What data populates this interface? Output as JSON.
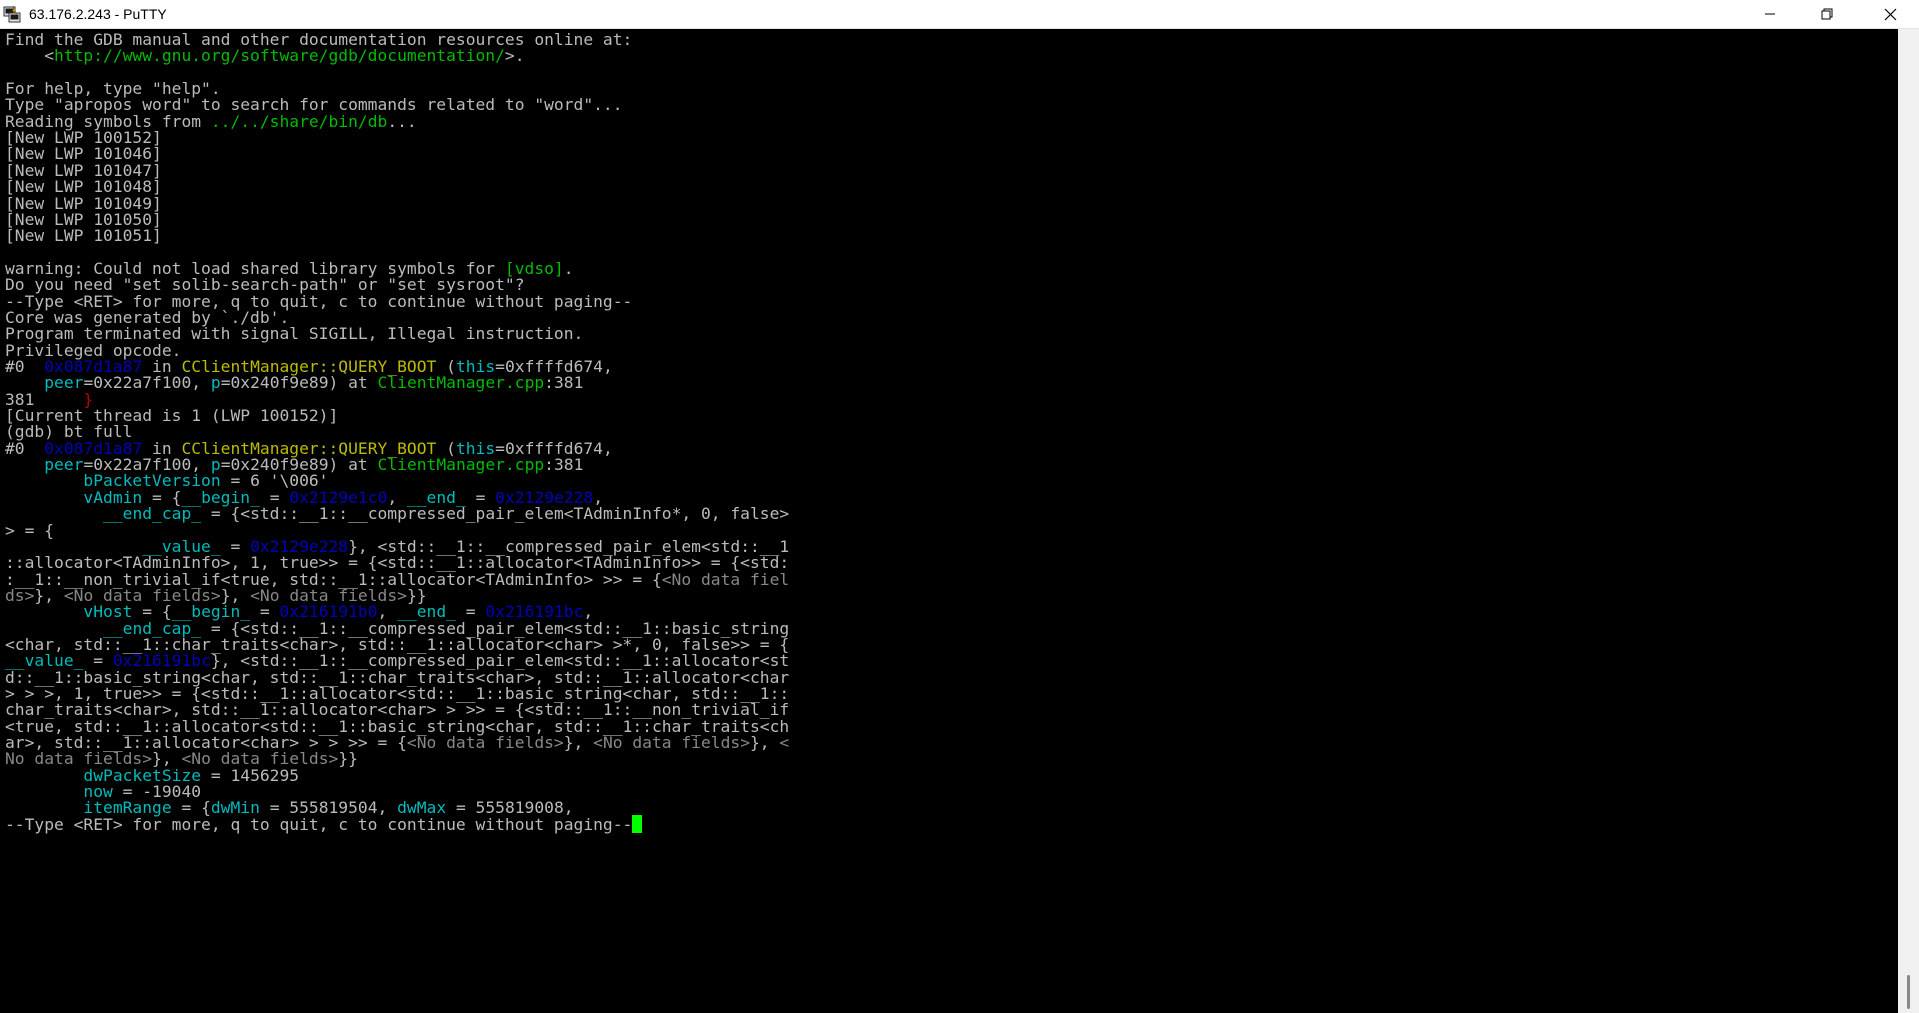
{
  "window": {
    "title": "63.176.2.243 - PuTTY",
    "app_icon": "putty-icon",
    "controls": {
      "minimize": "minimize-icon",
      "maximize": "restore-icon",
      "close": "close-icon"
    }
  },
  "colors": {
    "background": "#000000",
    "text": "#bbbbbb",
    "green": "#00bb00",
    "yellow": "#bbbb00",
    "blue": "#0000bb",
    "cyan": "#00bbbb",
    "red": "#bb0000",
    "gray": "#888888",
    "cursor": "#00ff00"
  },
  "terminal": {
    "lines": [
      [
        [
          "n",
          "Find the GDB manual and other documentation resources online at:"
        ]
      ],
      [
        [
          "n",
          "    <"
        ],
        [
          "u",
          "http://www.gnu.org/software/gdb/documentation/"
        ],
        [
          "n",
          ">."
        ]
      ],
      [],
      [
        [
          "n",
          "For help, type \"help\"."
        ]
      ],
      [
        [
          "n",
          "Type \"apropos word\" to search for commands related to \"word\"..."
        ]
      ],
      [
        [
          "n",
          "Reading symbols from "
        ],
        [
          "u",
          "../../share/bin/db"
        ],
        [
          "n",
          "..."
        ]
      ],
      [
        [
          "n",
          "[New LWP 100152]"
        ]
      ],
      [
        [
          "n",
          "[New LWP 101046]"
        ]
      ],
      [
        [
          "n",
          "[New LWP 101047]"
        ]
      ],
      [
        [
          "n",
          "[New LWP 101048]"
        ]
      ],
      [
        [
          "n",
          "[New LWP 101049]"
        ]
      ],
      [
        [
          "n",
          "[New LWP 101050]"
        ]
      ],
      [
        [
          "n",
          "[New LWP 101051]"
        ]
      ],
      [],
      [
        [
          "n",
          "warning: Could not load shared library symbols for "
        ],
        [
          "u",
          "[vdso]"
        ],
        [
          "n",
          "."
        ]
      ],
      [
        [
          "n",
          "Do you need \"set solib-search-path\" or \"set sysroot\"?"
        ]
      ],
      [
        [
          "n",
          "--Type <RET> for more, q to quit, c to continue without paging--"
        ]
      ],
      [
        [
          "n",
          "Core was generated by `./db'."
        ]
      ],
      [
        [
          "n",
          "Program terminated with signal SIGILL, Illegal instruction."
        ]
      ],
      [
        [
          "n",
          "Privileged opcode."
        ]
      ],
      [
        [
          "n",
          "#0  "
        ],
        [
          "a",
          "0x087d1a87"
        ],
        [
          "n",
          " in "
        ],
        [
          "f",
          "CClientManager::QUERY_BOOT"
        ],
        [
          "n",
          " ("
        ],
        [
          "v",
          "this"
        ],
        [
          "n",
          "=0xffffd674,"
        ]
      ],
      [
        [
          "n",
          "    "
        ],
        [
          "v",
          "peer"
        ],
        [
          "n",
          "=0x22a7f100, "
        ],
        [
          "v",
          "p"
        ],
        [
          "n",
          "=0x240f9e89) at "
        ],
        [
          "u",
          "ClientManager.cpp"
        ],
        [
          "n",
          ":381"
        ]
      ],
      [
        [
          "n",
          "381     "
        ],
        [
          "r",
          "}"
        ]
      ],
      [
        [
          "n",
          "[Current thread is 1 (LWP 100152)]"
        ]
      ],
      [
        [
          "n",
          "(gdb) bt full"
        ]
      ],
      [
        [
          "n",
          "#0  "
        ],
        [
          "a",
          "0x087d1a87"
        ],
        [
          "n",
          " in "
        ],
        [
          "f",
          "CClientManager::QUERY_BOOT"
        ],
        [
          "n",
          " ("
        ],
        [
          "v",
          "this"
        ],
        [
          "n",
          "=0xffffd674,"
        ]
      ],
      [
        [
          "n",
          "    "
        ],
        [
          "v",
          "peer"
        ],
        [
          "n",
          "=0x22a7f100, "
        ],
        [
          "v",
          "p"
        ],
        [
          "n",
          "=0x240f9e89) at "
        ],
        [
          "u",
          "ClientManager.cpp"
        ],
        [
          "n",
          ":381"
        ]
      ],
      [
        [
          "n",
          "        "
        ],
        [
          "v",
          "bPacketVersion"
        ],
        [
          "n",
          " = 6 '\\006'"
        ]
      ],
      [
        [
          "n",
          "        "
        ],
        [
          "v",
          "vAdmin"
        ],
        [
          "n",
          " = {"
        ],
        [
          "v",
          "__begin_"
        ],
        [
          "n",
          " = "
        ],
        [
          "a",
          "0x2129e1c0"
        ],
        [
          "n",
          ", "
        ],
        [
          "v",
          "__end_"
        ],
        [
          "n",
          " = "
        ],
        [
          "a",
          "0x2129e228"
        ],
        [
          "n",
          ","
        ]
      ],
      [
        [
          "n",
          "          "
        ],
        [
          "v",
          "__end_cap_"
        ],
        [
          "n",
          " = {<std::__1::__compressed_pair_elem<TAdminInfo*, 0, false>"
        ]
      ],
      [
        [
          "n",
          "> = {"
        ]
      ],
      [
        [
          "n",
          "              "
        ],
        [
          "v",
          "__value_"
        ],
        [
          "n",
          " = "
        ],
        [
          "a",
          "0x2129e228"
        ],
        [
          "n",
          "}, <std::__1::__compressed_pair_elem<std::__1"
        ]
      ],
      [
        [
          "n",
          "::allocator<TAdminInfo>, 1, true>> = {<std::__1::allocator<TAdminInfo>> = {<std:"
        ]
      ],
      [
        [
          "n",
          ":__1::__non_trivial_if<true, std::__1::allocator<TAdminInfo> >> = {"
        ],
        [
          "d",
          "<No data fiel"
        ]
      ],
      [
        [
          "d",
          "ds>"
        ],
        [
          "n",
          "}, "
        ],
        [
          "d",
          "<No data fields>"
        ],
        [
          "n",
          "}, "
        ],
        [
          "d",
          "<No data fields>"
        ],
        [
          "n",
          "}}"
        ]
      ],
      [
        [
          "n",
          "        "
        ],
        [
          "v",
          "vHost"
        ],
        [
          "n",
          " = {"
        ],
        [
          "v",
          "__begin_"
        ],
        [
          "n",
          " = "
        ],
        [
          "a",
          "0x216191b0"
        ],
        [
          "n",
          ", "
        ],
        [
          "v",
          "__end_"
        ],
        [
          "n",
          " = "
        ],
        [
          "a",
          "0x216191bc"
        ],
        [
          "n",
          ","
        ]
      ],
      [
        [
          "n",
          "          "
        ],
        [
          "v",
          "__end_cap_"
        ],
        [
          "n",
          " = {<std::__1::__compressed_pair_elem<std::__1::basic_string"
        ]
      ],
      [
        [
          "n",
          "<char, std::__1::char_traits<char>, std::__1::allocator<char> >*, 0, false>> = {"
        ]
      ],
      [
        [
          "v",
          "__value_"
        ],
        [
          "n",
          " = "
        ],
        [
          "a",
          "0x216191bc"
        ],
        [
          "n",
          "}, <std::__1::__compressed_pair_elem<std::__1::allocator<st"
        ]
      ],
      [
        [
          "n",
          "d::__1::basic_string<char, std::__1::char_traits<char>, std::__1::allocator<char"
        ]
      ],
      [
        [
          "n",
          "> > >, 1, true>> = {<std::__1::allocator<std::__1::basic_string<char, std::__1::"
        ]
      ],
      [
        [
          "n",
          "char_traits<char>, std::__1::allocator<char> > >> = {<std::__1::__non_trivial_if"
        ]
      ],
      [
        [
          "n",
          "<true, std::__1::allocator<std::__1::basic_string<char, std::__1::char_traits<ch"
        ]
      ],
      [
        [
          "n",
          "ar>, std::__1::allocator<char> > > >> = {"
        ],
        [
          "d",
          "<No data fields>"
        ],
        [
          "n",
          "}, "
        ],
        [
          "d",
          "<No data fields>"
        ],
        [
          "n",
          "}, "
        ],
        [
          "d",
          "<"
        ]
      ],
      [
        [
          "d",
          "No data fields>"
        ],
        [
          "n",
          "}, "
        ],
        [
          "d",
          "<No data fields>"
        ],
        [
          "n",
          "}}"
        ]
      ],
      [
        [
          "n",
          "        "
        ],
        [
          "v",
          "dwPacketSize"
        ],
        [
          "n",
          " = 1456295"
        ]
      ],
      [
        [
          "n",
          "        "
        ],
        [
          "v",
          "now"
        ],
        [
          "n",
          " = -19040"
        ]
      ],
      [
        [
          "n",
          "        "
        ],
        [
          "v",
          "itemRange"
        ],
        [
          "n",
          " = {"
        ],
        [
          "v",
          "dwMin"
        ],
        [
          "n",
          " = 555819504, "
        ],
        [
          "v",
          "dwMax"
        ],
        [
          "n",
          " = 555819008,"
        ]
      ],
      [
        [
          "n",
          "--Type <RET> for more, q to quit, c to continue without paging--"
        ],
        [
          "c",
          ""
        ]
      ]
    ]
  }
}
